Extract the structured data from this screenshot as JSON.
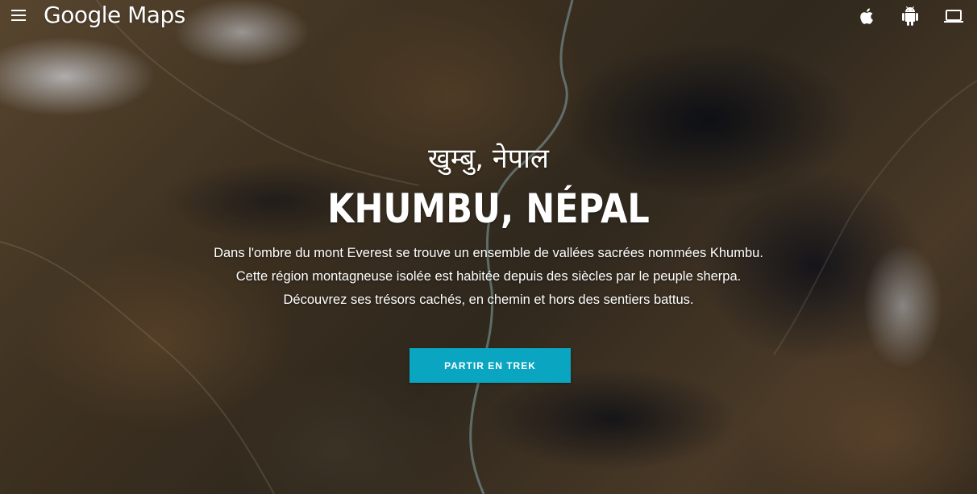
{
  "header": {
    "logo_text": "Google Maps",
    "menu_icon": "hamburger-menu-icon",
    "platforms": [
      {
        "name": "apple-icon"
      },
      {
        "name": "android-icon"
      },
      {
        "name": "laptop-icon"
      }
    ]
  },
  "hero": {
    "title_native": "खुम्बु, नेपाल",
    "title": "KHUMBU, NÉPAL",
    "description": [
      "Dans l'ombre du mont Everest se trouve un ensemble de vallées sacrées nommées Khumbu.",
      "Cette région montagneuse isolée est habitée depuis des siècles par le peuple sherpa.",
      "Découvrez ses trésors cachés, en chemin et hors des sentiers battus."
    ],
    "cta_label": "PARTIR EN TREK"
  },
  "colors": {
    "cta_background": "#0aa5c0",
    "text": "#ffffff"
  }
}
